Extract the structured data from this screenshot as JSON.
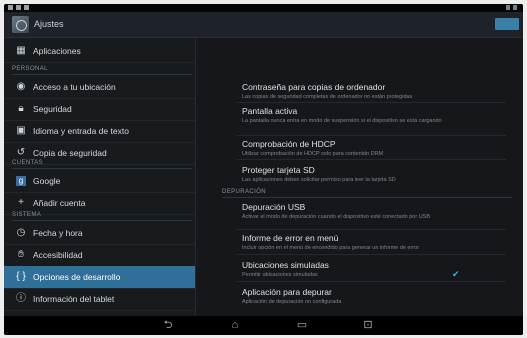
{
  "actionbar": {
    "title": "Ajustes"
  },
  "sidebar": {
    "items": [
      {
        "label": "Aplicaciones",
        "icon": "apps-icon"
      },
      {
        "label": "Acceso a tu ubicación",
        "icon": "location-icon"
      },
      {
        "label": "Seguridad",
        "icon": "lock-icon"
      },
      {
        "label": "Idioma y entrada de texto",
        "icon": "keyboard-icon"
      },
      {
        "label": "Copia de seguridad",
        "icon": "backup-icon"
      },
      {
        "label": "Google",
        "icon": "google-icon"
      },
      {
        "label": "Añadir cuenta",
        "icon": "plus-icon"
      },
      {
        "label": "Fecha y hora",
        "icon": "clock-icon"
      },
      {
        "label": "Accesibilidad",
        "icon": "accessibility-icon"
      },
      {
        "label": "Opciones de desarrollo",
        "icon": "code-braces-icon",
        "active": true
      },
      {
        "label": "Información del tablet",
        "icon": "info-icon"
      }
    ],
    "sections": {
      "personal": "PERSONAL",
      "cuentas": "CUENTAS",
      "sistema": "SISTEMA"
    }
  },
  "content": {
    "depuracion_header": "DEPURACIÓN",
    "prefs": [
      {
        "title": "Contraseña para copias de ordenador",
        "summary": "Las copias de seguridad completas de ordenador no están protegidas"
      },
      {
        "title": "Pantalla activa",
        "summary": "La pantalla nunca entra en modo de suspensión si el dispositivo se está cargando"
      },
      {
        "title": "Comprobación de HDCP",
        "summary": "Utilizar comprobación de HDCP solo para contenido DRM"
      },
      {
        "title": "Proteger tarjeta SD",
        "summary": "Las aplicaciones deben solicitar permiso para leer la tarjeta SD"
      },
      {
        "title": "Depuración USB",
        "summary": "Activar el modo de depuración cuando el dispositivo esté conectado por USB"
      },
      {
        "title": "Informe de error en menú",
        "summary": "Incluir opción en el menú de encendido para generar un informe de error"
      },
      {
        "title": "Ubicaciones simuladas",
        "summary": "Permitir ubicaciones simuladas",
        "checked": true
      },
      {
        "title": "Aplicación para depurar",
        "summary": "Aplicación de depuración no configurada"
      }
    ]
  },
  "navbar": {
    "buttons": [
      "back-icon",
      "home-icon",
      "recent-apps-icon",
      "screenshot-icon"
    ]
  },
  "colors": {
    "accent": "#33b5e5",
    "selected": "#2f6f98",
    "background": "#15171a"
  }
}
